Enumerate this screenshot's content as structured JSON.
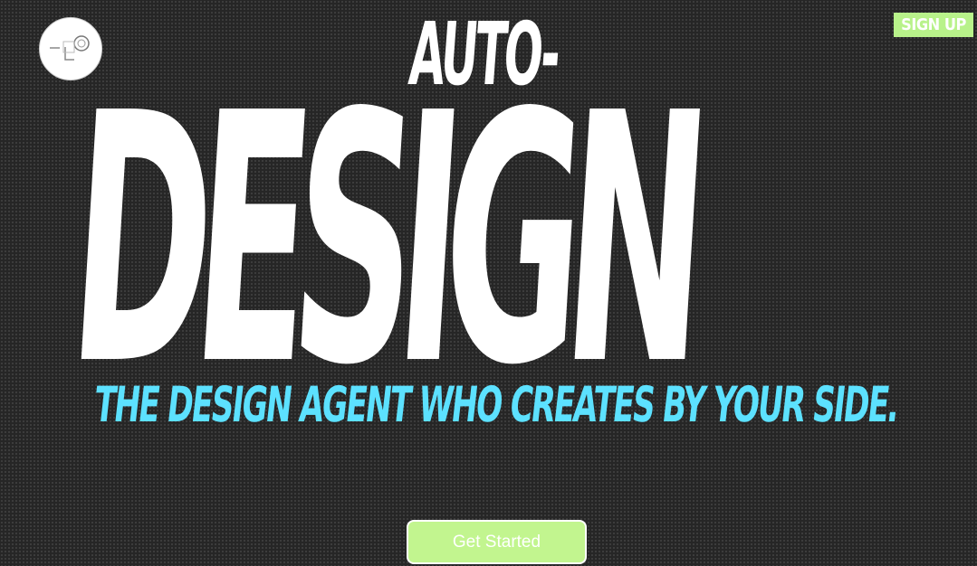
{
  "header": {
    "logo_icon": "circle-lens-logo-icon",
    "signup_label": "SIGN UP"
  },
  "hero": {
    "title_top": "AUTO-",
    "title_main": "DESIGN",
    "tagline": "THE DESIGN AGENT WHO CREATES BY YOUR SIDE.",
    "cta_label": "Get Started"
  },
  "colors": {
    "background": "#262626",
    "title": "#ffffff",
    "tagline": "#5ce1ff",
    "accent_green": "#b8f28a"
  }
}
